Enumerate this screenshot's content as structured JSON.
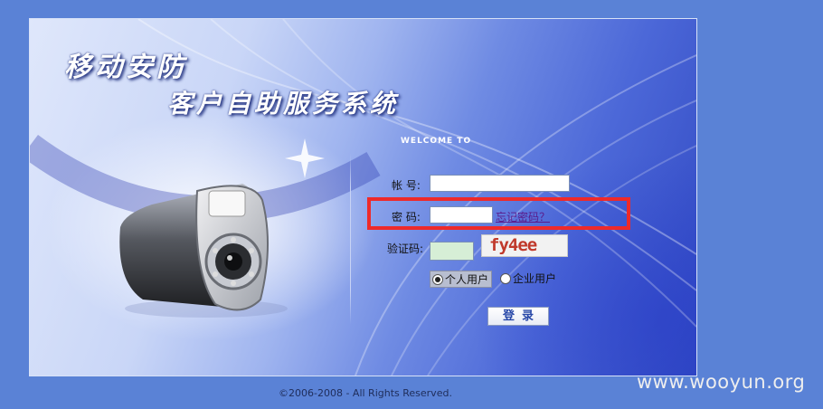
{
  "brand": {
    "title_line1": "移动安防",
    "title_line2": "客户自助服务系统"
  },
  "login": {
    "welcome": "WELCOME TO",
    "account_label": "帐 号:",
    "account_value": "",
    "password_label": "密 码:",
    "password_value": "",
    "forgot_link": "忘记密码？",
    "captcha_label": "验证码:",
    "captcha_value": "",
    "captcha_text": "fy4ee",
    "user_types": [
      {
        "label": "个人用户",
        "checked": true
      },
      {
        "label": "企业用户",
        "checked": false
      }
    ],
    "submit_label": "登录"
  },
  "footer": {
    "copyright": "©2006-2008 - All Rights Reserved."
  },
  "watermark": "www.wooyun.org",
  "colors": {
    "page_background": "#5a82d6",
    "highlight_box": "#ee2a2a",
    "captcha_field": "#d6eed6",
    "link": "#5a1a8a"
  }
}
